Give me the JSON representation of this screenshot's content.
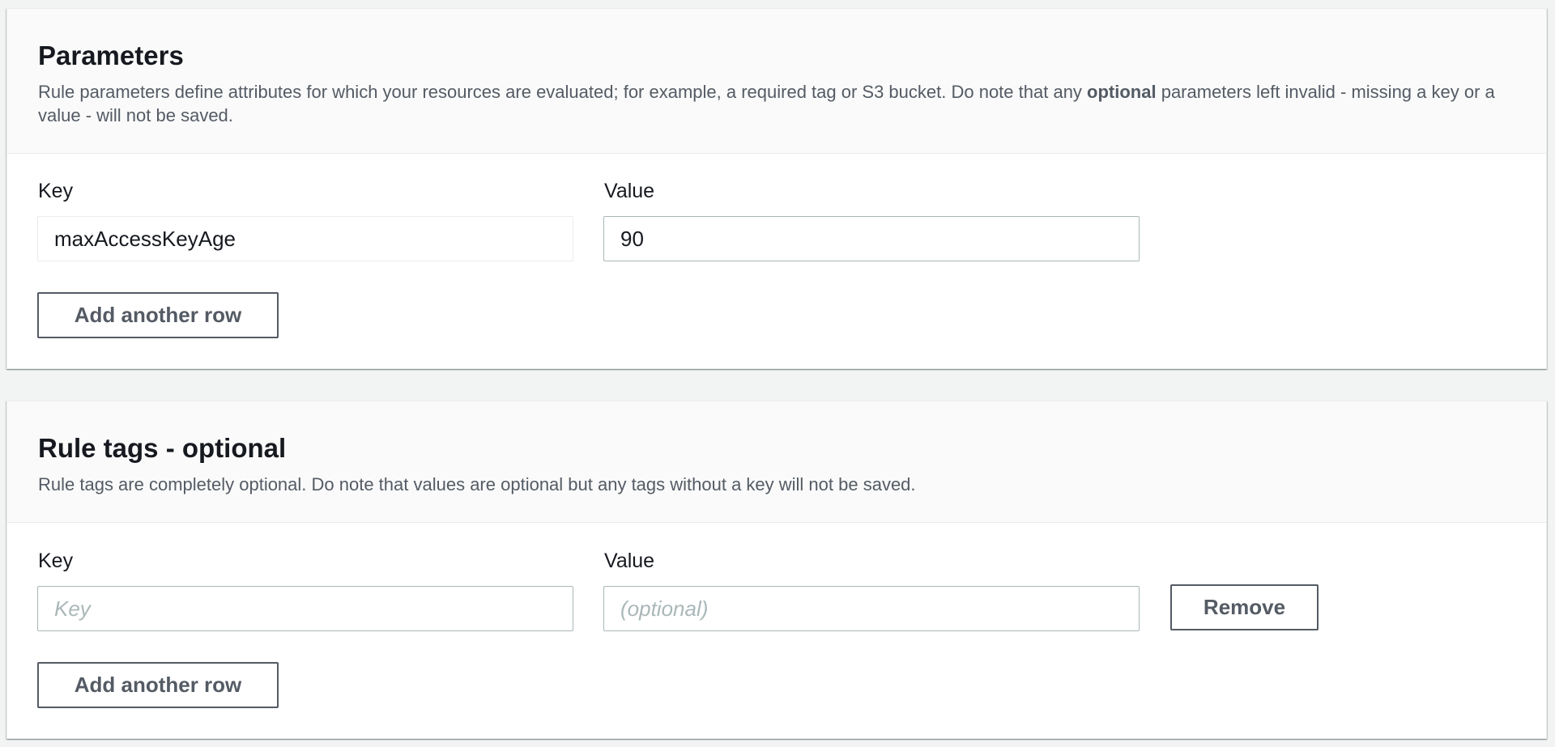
{
  "parameters": {
    "title": "Parameters",
    "description_part1": "Rule parameters define attributes for which your resources are evaluated; for example, a required tag or S3 bucket. Do note that any ",
    "description_bold": "optional",
    "description_part2": " parameters left invalid - missing a key or a value - will not be saved.",
    "key_label": "Key",
    "value_label": "Value",
    "row": {
      "key": "maxAccessKeyAge",
      "value": "90"
    },
    "add_row_label": "Add another row"
  },
  "rule_tags": {
    "title": "Rule tags - optional",
    "description": "Rule tags are completely optional. Do note that values are optional but any tags without a key will not be saved.",
    "key_label": "Key",
    "value_label": "Value",
    "row": {
      "key": "",
      "key_placeholder": "Key",
      "value": "",
      "value_placeholder": "(optional)"
    },
    "remove_label": "Remove",
    "add_row_label": "Add another row"
  }
}
